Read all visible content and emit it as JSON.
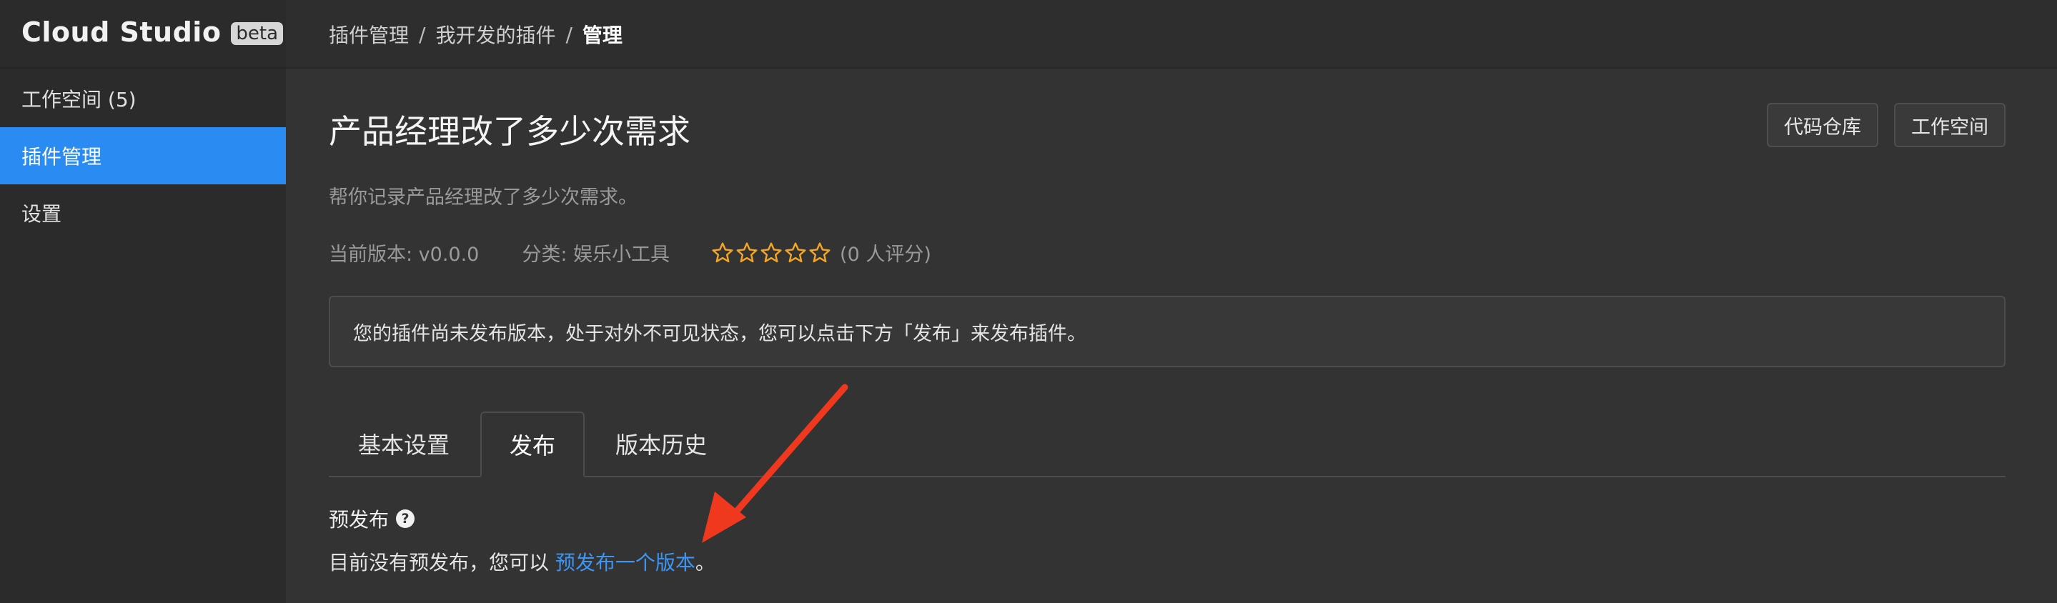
{
  "brand": {
    "name": "Cloud Studio",
    "badge": "beta"
  },
  "sidebar": {
    "items": [
      {
        "label": "工作空间 (5)"
      },
      {
        "label": "插件管理",
        "active": true
      },
      {
        "label": "设置"
      }
    ]
  },
  "breadcrumb": {
    "items": [
      "插件管理",
      "我开发的插件",
      "管理"
    ],
    "separator": "/"
  },
  "plugin": {
    "title": "产品经理改了多少次需求",
    "description": "帮你记录产品经理改了多少次需求。",
    "version": "当前版本: v0.0.0",
    "category": "分类: 娱乐小工具",
    "rating": {
      "stars": 0,
      "max": 5,
      "label": "(0 人评分)"
    }
  },
  "header_actions": {
    "repo_label": "代码仓库",
    "workspace_label": "工作空间"
  },
  "notice": {
    "text": "您的插件尚未发布版本，处于对外不可见状态，您可以点击下方「发布」来发布插件。"
  },
  "tabs": [
    {
      "label": "基本设置"
    },
    {
      "label": "发布",
      "active": true
    },
    {
      "label": "版本历史"
    }
  ],
  "prerelease": {
    "title": "预发布",
    "help_icon": "?",
    "text_prefix": "目前没有预发布，您可以 ",
    "link_label": "预发布一个版本",
    "text_suffix": "。"
  },
  "colors": {
    "accent": "#2a8bf2",
    "link": "#3d96f5",
    "star": "#f5a623",
    "annotation_arrow": "#f0381f"
  },
  "icons": {
    "star": "star-outline-icon",
    "help": "question-circle-icon",
    "annotation": "red-arrow-annotation"
  }
}
